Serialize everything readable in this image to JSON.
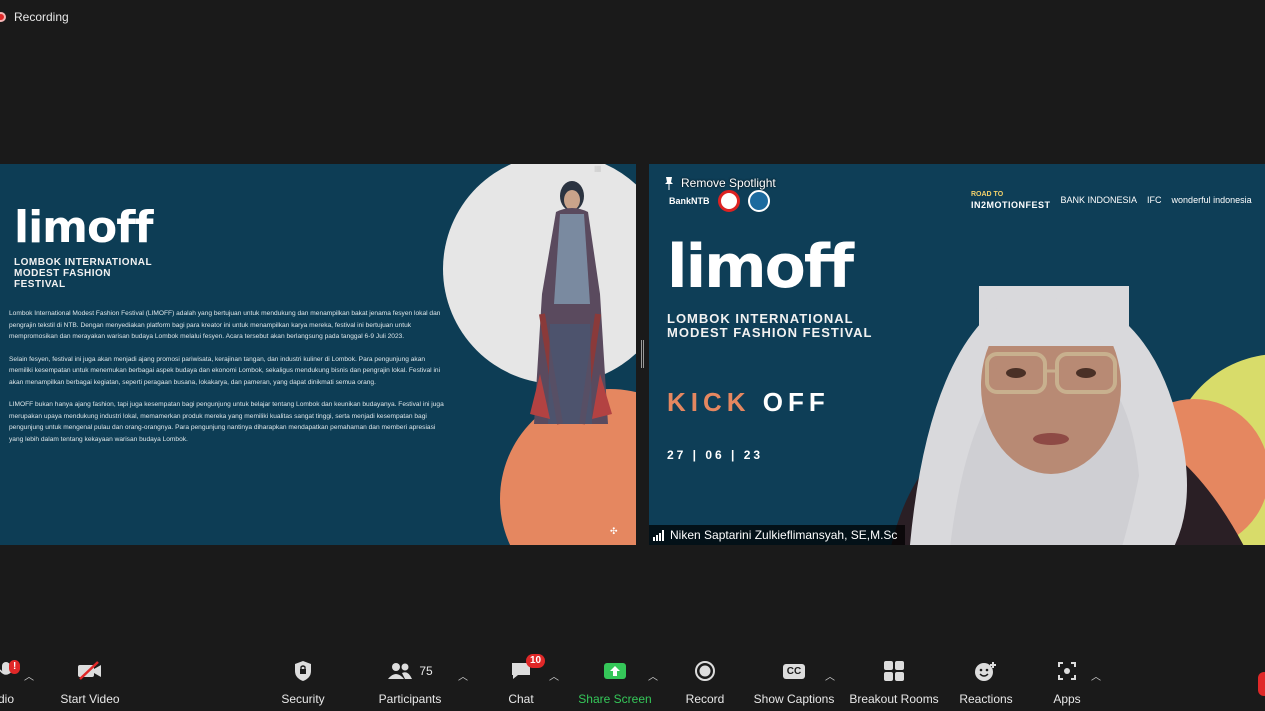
{
  "recording": {
    "label": "Recording"
  },
  "share": {
    "logo": "limoff",
    "subtitle": "LOMBOK INTERNATIONAL MODEST FASHION FESTIVAL",
    "paragraphs": [
      "Lombok International Modest Fashion Festival (LIMOFF) adalah yang bertujuan untuk mendukung dan menampilkan bakat jenama fesyen lokal dan pengrajin tekstil di NTB. Dengan menyediakan platform bagi para kreator ini untuk menampilkan karya mereka, festival ini bertujuan untuk mempromosikan dan merayakan warisan budaya Lombok melalui fesyen. Acara tersebut akan berlangsung pada tanggal 6-9 Juli 2023.",
      "Selain fesyen, festival ini juga akan menjadi ajang promosi pariwisata, kerajinan tangan, dan industri kuliner di Lombok. Para pengunjung akan memiliki kesempatan untuk menemukan berbagai aspek budaya dan ekonomi Lombok, sekaligus mendukung bisnis dan pengrajin lokal. Festival ini akan menampilkan berbagai kegiatan, seperti peragaan busana, lokakarya, dan pameran, yang dapat dinikmati semua orang.",
      "LIMOFF bukan hanya ajang fashion, tapi juga kesempatan bagi pengunjung untuk belajar tentang Lombok dan keunikan budayanya. Festival ini juga merupakan upaya mendukung industri lokal, memamerkan produk mereka yang memiliki kualitas sangat tinggi, serta menjadi kesempatan bagi pengunjung untuk mengenal pulau dan orang-orangnya. Para pengunjung nantinya diharapkan mendapatkan pemahaman dan memberi apresiasi yang lebih dalam tentang kekayaan warisan budaya Lombok."
    ]
  },
  "camera": {
    "spotlight_label": "Remove Spotlight",
    "bank_ntb": "BankNTB",
    "road_to": "ROAD TO",
    "in2motion": "IN2MOTIONFEST",
    "bank_indonesia": "BANK INDONESIA",
    "ifc": "IFC",
    "wonderful": "wonderful indonesia",
    "logo": "limoff",
    "subtitle": "LOMBOK INTERNATIONAL MODEST FASHION FESTIVAL",
    "kick": "KICK",
    "off": "OFF",
    "date": "27 | 06 | 23",
    "participant_name": "Niken Saptarini Zulkieflimansyah, SE,M.Sc"
  },
  "toolbar": {
    "audio_label": "dio",
    "audio_badge": "!",
    "video_label": "Start Video",
    "security_label": "Security",
    "participants_label": "Participants",
    "participants_count": "75",
    "chat_label": "Chat",
    "chat_badge": "10",
    "share_label": "Share Screen",
    "record_label": "Record",
    "captions_label": "Show Captions",
    "captions_icon_text": "CC",
    "breakout_label": "Breakout Rooms",
    "reactions_label": "Reactions",
    "apps_label": "Apps"
  },
  "colors": {
    "slide_bg": "#0d3d55",
    "accent_orange": "#e58760",
    "accent_yellow": "#d8dc6a",
    "share_green": "#35c759",
    "badge_red": "#e02828"
  }
}
